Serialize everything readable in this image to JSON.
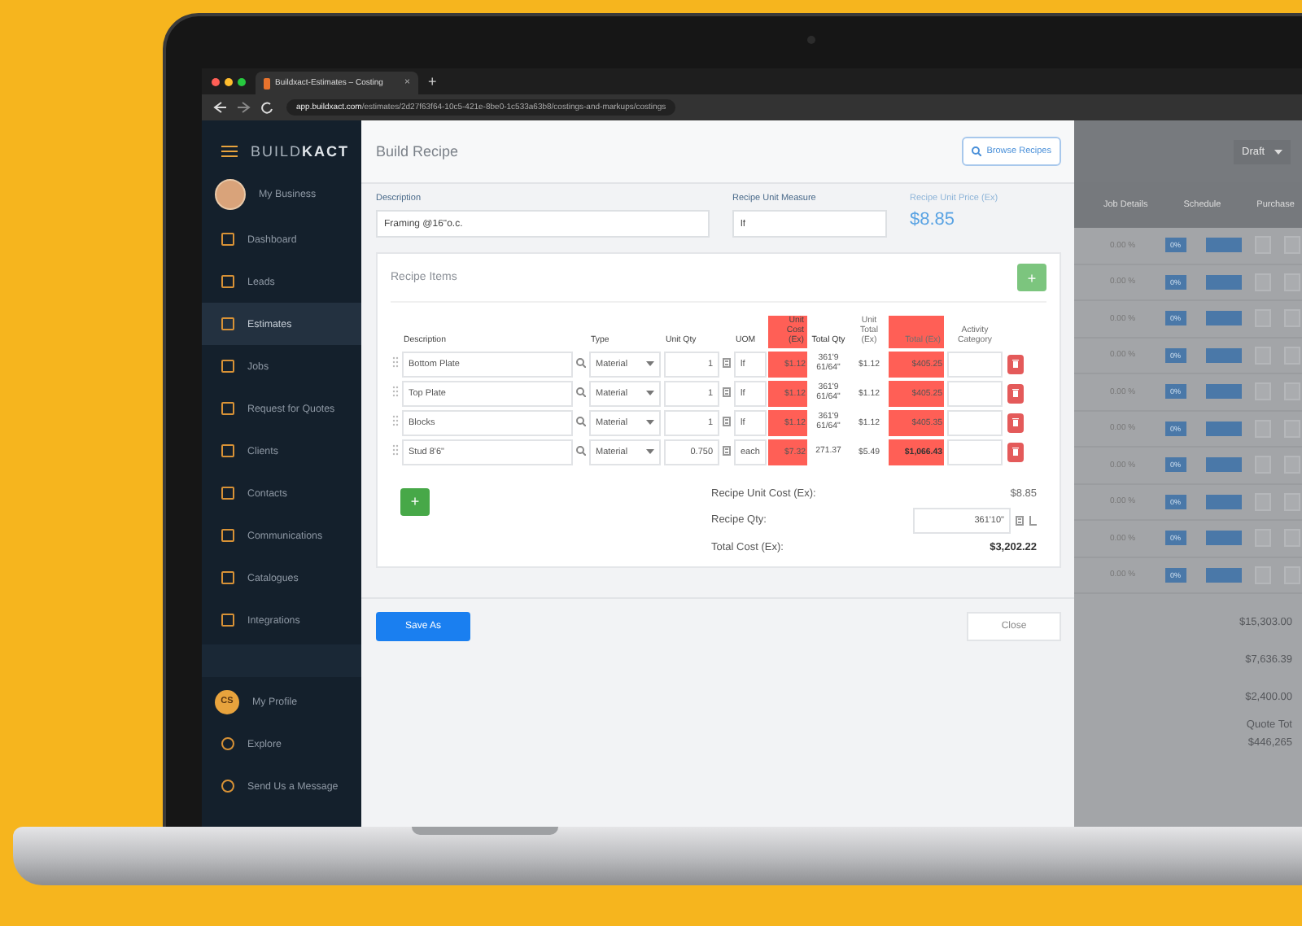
{
  "browser": {
    "tab_title": "Buildxact-Estimates – Costing",
    "tab_close": "×",
    "new_tab": "+",
    "url_host": "app.buildxact.com",
    "url_path": "/estimates/2d27f63f64-10c5-421e-8be0-1c533a63b8/costings-and-markups/costings"
  },
  "sidebar": {
    "logo_light": "BUILD",
    "logo_bold": "KACT",
    "business": "My Business",
    "items": [
      {
        "label": "Dashboard",
        "selected": false
      },
      {
        "label": "Leads",
        "selected": false
      },
      {
        "label": "Estimates",
        "selected": true
      },
      {
        "label": "Jobs",
        "selected": false
      },
      {
        "label": "Request for Quotes",
        "selected": false
      },
      {
        "label": "Clients",
        "selected": false
      },
      {
        "label": "Contacts",
        "selected": false
      },
      {
        "label": "Communications",
        "selected": false
      },
      {
        "label": "Catalogues",
        "selected": false
      },
      {
        "label": "Integrations",
        "selected": false
      }
    ],
    "profile": {
      "initials": "CS",
      "label": "My Profile"
    },
    "bottom_items": [
      "Explore",
      "Send Us a Message"
    ]
  },
  "modal": {
    "title": "Build Recipe",
    "browse_button": "Browse Recipes",
    "description": {
      "label": "Description",
      "value": "Framing @16\"o.c."
    },
    "unit_measure": {
      "label": "Recipe Unit Measure",
      "value": "lf"
    },
    "unit_price": {
      "label": "Recipe Unit Price (Ex)",
      "value": "$8.85"
    },
    "items_title": "Recipe Items",
    "add_symbol": "+",
    "columns": [
      "Description",
      "Type",
      "Unit Qty",
      "UOM",
      "Unit Cost (Ex)",
      "Total Qty",
      "Unit Total (Ex)",
      "Total (Ex)",
      "Activity Category"
    ],
    "rows": [
      {
        "description": "Bottom Plate",
        "type": "Material",
        "qty": "1",
        "uom": "lf",
        "unit_cost": "$1.12",
        "total_qty": "361'9 61/64\"",
        "unit_total": "$1.12",
        "total": "$405.25",
        "bold": false
      },
      {
        "description": "Top Plate",
        "type": "Material",
        "qty": "1",
        "uom": "lf",
        "unit_cost": "$1.12",
        "total_qty": "361'9 61/64\"",
        "unit_total": "$1.12",
        "total": "$405.25",
        "bold": false
      },
      {
        "description": "Blocks",
        "type": "Material",
        "qty": "1",
        "uom": "lf",
        "unit_cost": "$1.12",
        "total_qty": "361'9 61/64\"",
        "unit_total": "$1.12",
        "total": "$405.35",
        "bold": false
      },
      {
        "description": "Stud 8'6\"",
        "type": "Material",
        "qty": "0.750",
        "uom": "each",
        "unit_cost": "$7.32",
        "total_qty": "271.37",
        "unit_total": "$5.49",
        "total": "$1,066.43",
        "bold": true
      }
    ],
    "unit_cost_label": "Recipe Unit Cost (Ex):",
    "unit_cost_value": "$8.85",
    "qty_label": "Recipe Qty:",
    "qty_value": "361'10\"",
    "total_label": "Total Cost (Ex):",
    "total_value": "$3,202.22",
    "save_button": "Save As",
    "close_button": "Close"
  },
  "background": {
    "status": "Draft",
    "columns": [
      "Job Details",
      "Schedule",
      "Purchase"
    ],
    "rows": [
      {
        "percent": "0.00 %",
        "badge": "0%"
      },
      {
        "percent": "0.00 %",
        "badge": "0%"
      },
      {
        "percent": "0.00 %",
        "badge": "0%"
      },
      {
        "percent": "0.00 %",
        "badge": "0%"
      },
      {
        "percent": "0.00 %",
        "badge": "0%"
      },
      {
        "percent": "0.00 %",
        "badge": "0%"
      },
      {
        "percent": "0.00 %",
        "badge": "0%"
      },
      {
        "percent": "0.00 %",
        "badge": "0%"
      },
      {
        "percent": "0.00 %",
        "badge": "0%"
      },
      {
        "percent": "0.00 %",
        "badge": "0%"
      }
    ],
    "totals": [
      "$15,303.00",
      "$7,636.39",
      "$2,400.00"
    ],
    "quote_label": "Quote Tot",
    "quote_value": "$446,265"
  }
}
